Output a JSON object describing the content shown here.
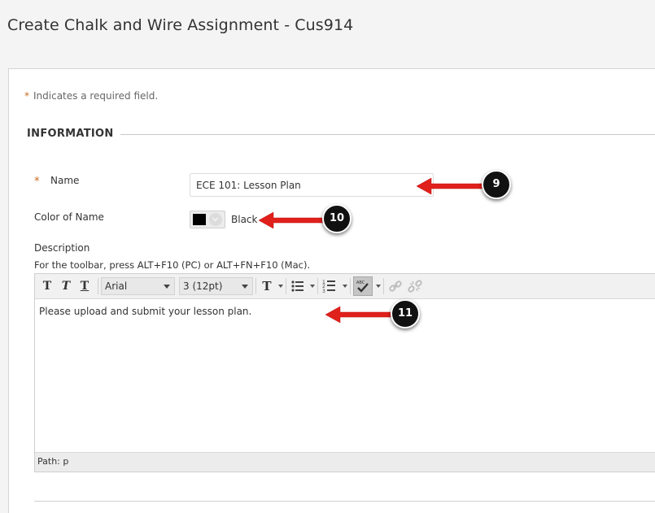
{
  "page": {
    "title": "Create Chalk and Wire Assignment - Cus914"
  },
  "form": {
    "required_star": "*",
    "required_note": "Indicates a required field.",
    "section_heading": "INFORMATION",
    "name": {
      "label": "Name",
      "value": "ECE 101: Lesson Plan"
    },
    "color": {
      "label": "Color of Name",
      "value": "Black",
      "swatch": "#000000"
    },
    "description": {
      "label": "Description",
      "toolbar_hint": "For the toolbar, press ALT+F10 (PC) or ALT+FN+F10 (Mac).",
      "body_text": "Please upload and submit your lesson plan.",
      "path_text": "Path: p"
    }
  },
  "toolbar": {
    "bold_glyph": "T",
    "italic_glyph": "T",
    "underline_glyph": "T",
    "font_family": "Arial",
    "font_size": "3 (12pt)",
    "text_color_glyph": "T",
    "icons": [
      "text-color-icon",
      "bullet-list-icon",
      "numbered-list-icon",
      "spellcheck-icon",
      "link-icon",
      "unlink-icon"
    ]
  },
  "callouts": {
    "badge_9": "9",
    "badge_10": "10",
    "badge_11": "11",
    "arrow_color": "#e0201b"
  },
  "colors": {
    "accent_required": "#c96b1e"
  }
}
